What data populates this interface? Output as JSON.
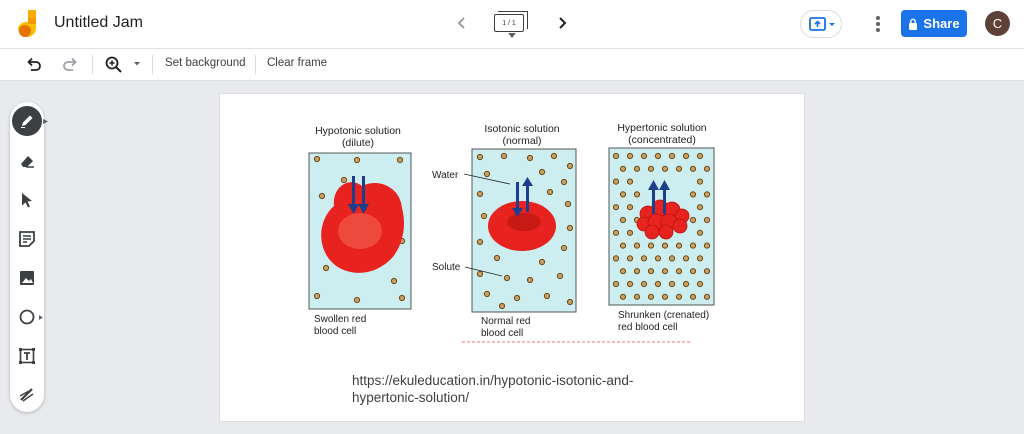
{
  "header": {
    "title": "Untitled Jam",
    "frame_indicator": "1 / 1",
    "share_label": "Share",
    "avatar_letter": "C"
  },
  "toolbar": {
    "set_background_label": "Set background",
    "clear_frame_label": "Clear frame"
  },
  "tools": [
    "pen-tool",
    "eraser-tool",
    "select-tool",
    "sticky-note-tool",
    "image-tool",
    "shape-tool",
    "text-box-tool",
    "laser-tool"
  ],
  "figure": {
    "panels": [
      {
        "heading_line1": "Hypotonic solution",
        "heading_line2": "(dilute)",
        "caption_line1": "Swollen red",
        "caption_line2": "blood cell"
      },
      {
        "heading_line1": "Isotonic solution",
        "heading_line2": "(normal)",
        "caption_line1": "Normal red",
        "caption_line2": "blood cell"
      },
      {
        "heading_line1": "Hypertonic solution",
        "heading_line2": "(concentrated)",
        "caption_line1": "Shrunken (crenated)",
        "caption_line2": "red blood cell"
      }
    ],
    "label_water": "Water",
    "label_solute": "Solute"
  },
  "canvas": {
    "url_line1": "https://ekuleducation.in/hypotonic-isotonic-and-",
    "url_line2": "hypertonic-solution/"
  },
  "colors": {
    "accent": "#1a73e8",
    "solution_fill": "#cdeef1",
    "cell_red": "#e8231f",
    "arrow_blue": "#1c3f8c",
    "solute_dot": "#b5893f"
  }
}
